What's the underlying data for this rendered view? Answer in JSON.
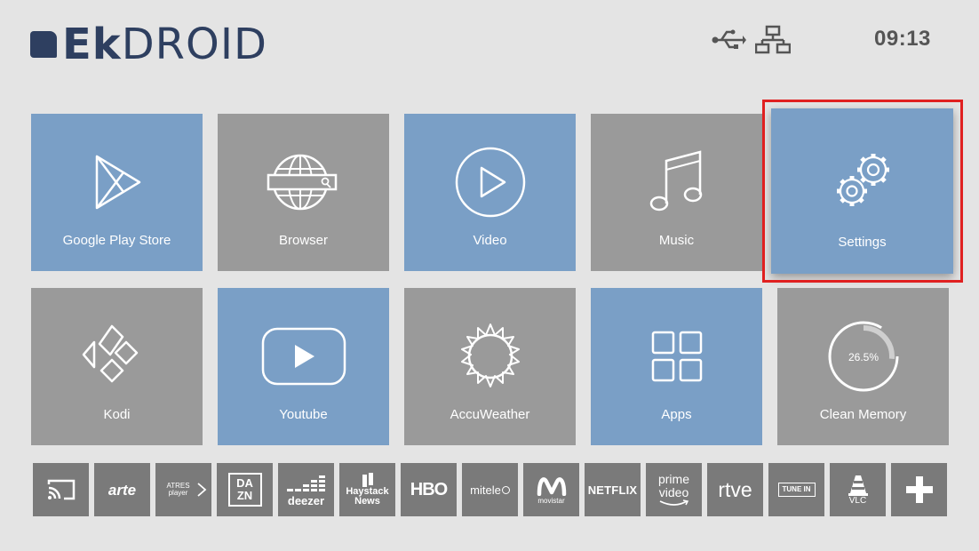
{
  "brand": {
    "ek": "Ek",
    "droid": "DROID"
  },
  "status": {
    "usb_icon": "usb-icon",
    "network_icon": "ethernet-icon",
    "time": "09:13"
  },
  "tiles": [
    {
      "label": "Google Play Store",
      "icon": "play-store-icon"
    },
    {
      "label": "Browser",
      "icon": "globe-icon"
    },
    {
      "label": "Video",
      "icon": "play-circle-icon"
    },
    {
      "label": "Music",
      "icon": "music-note-icon"
    },
    {
      "label": "Settings",
      "icon": "gears-icon"
    },
    {
      "label": "Kodi",
      "icon": "kodi-icon"
    },
    {
      "label": "Youtube",
      "icon": "youtube-icon"
    },
    {
      "label": "AccuWeather",
      "icon": "sun-icon"
    },
    {
      "label": "Apps",
      "icon": "grid-icon"
    },
    {
      "label": "Clean Memory",
      "icon": "memory-ring-icon",
      "value": "26.5%"
    }
  ],
  "dock": [
    {
      "label": "",
      "icon": "cast-icon"
    },
    {
      "label": "arte"
    },
    {
      "label": "ATRES player"
    },
    {
      "label": "DA ZN"
    },
    {
      "label": "deezer"
    },
    {
      "label": "Haystack News"
    },
    {
      "label": "HBO"
    },
    {
      "label": "mitele"
    },
    {
      "label": "movistar"
    },
    {
      "label": "NETFLIX"
    },
    {
      "label": "prime video"
    },
    {
      "label": "rtve"
    },
    {
      "label": "TUNE IN"
    },
    {
      "label": "VLC"
    },
    {
      "label": "",
      "icon": "plus-icon"
    }
  ],
  "colors": {
    "blue_tile": "#7a9fc6",
    "grey_tile": "#9a9a9a",
    "dock_tile": "#7a7a7a",
    "brand": "#2e3f60",
    "focus": "#e02020"
  }
}
